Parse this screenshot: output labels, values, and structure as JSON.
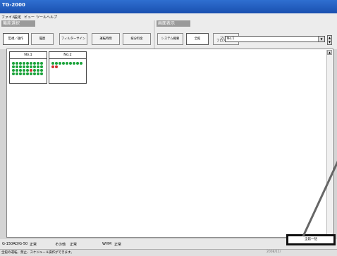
{
  "app": {
    "title": "TG-2000"
  },
  "menu": [
    "ファイル",
    "設定",
    "ビュー",
    "ツール",
    "ヘルプ"
  ],
  "left_panel": {
    "label": "機能選択",
    "buttons": [
      "監視／操作",
      "履歴",
      "フィルターサイン",
      "運転時間",
      "按分料金"
    ]
  },
  "right_panel": {
    "label": "画面表示",
    "buttons": [
      "システム概要",
      "全館",
      "ブロック"
    ],
    "floor_label": "フロアー",
    "floor_value": "No.1"
  },
  "cards": [
    {
      "name": "No.1",
      "dots": [
        "g",
        "g",
        "g",
        "g",
        "g",
        "g",
        "g",
        "g",
        "g",
        "g",
        "g",
        "g",
        "g",
        "g",
        "g",
        "g",
        "g",
        "g",
        "g",
        "g",
        "g",
        "g",
        "g",
        "r",
        "g",
        "g",
        "g",
        "g",
        "g",
        "g",
        "g",
        "g",
        "g",
        "g",
        "g",
        "g"
      ]
    },
    {
      "name": "No.2",
      "dots": [
        "g",
        "g",
        "g",
        "g",
        "g",
        "g",
        "g",
        "g",
        "g",
        "r",
        "r"
      ]
    }
  ],
  "colors": {
    "g": "#1aa33a",
    "r": "#d03030"
  },
  "status": {
    "item1_label": "G-150AD/G-50",
    "item1_value": "正常",
    "item2_label": "その他",
    "item2_value": "正常",
    "item3_label": "WHM",
    "item3_value": "正常"
  },
  "bottom_button": "全館一括",
  "message": "全館の運転、禁止、スケジュール操作ができます。",
  "datetime": "2008/11/"
}
